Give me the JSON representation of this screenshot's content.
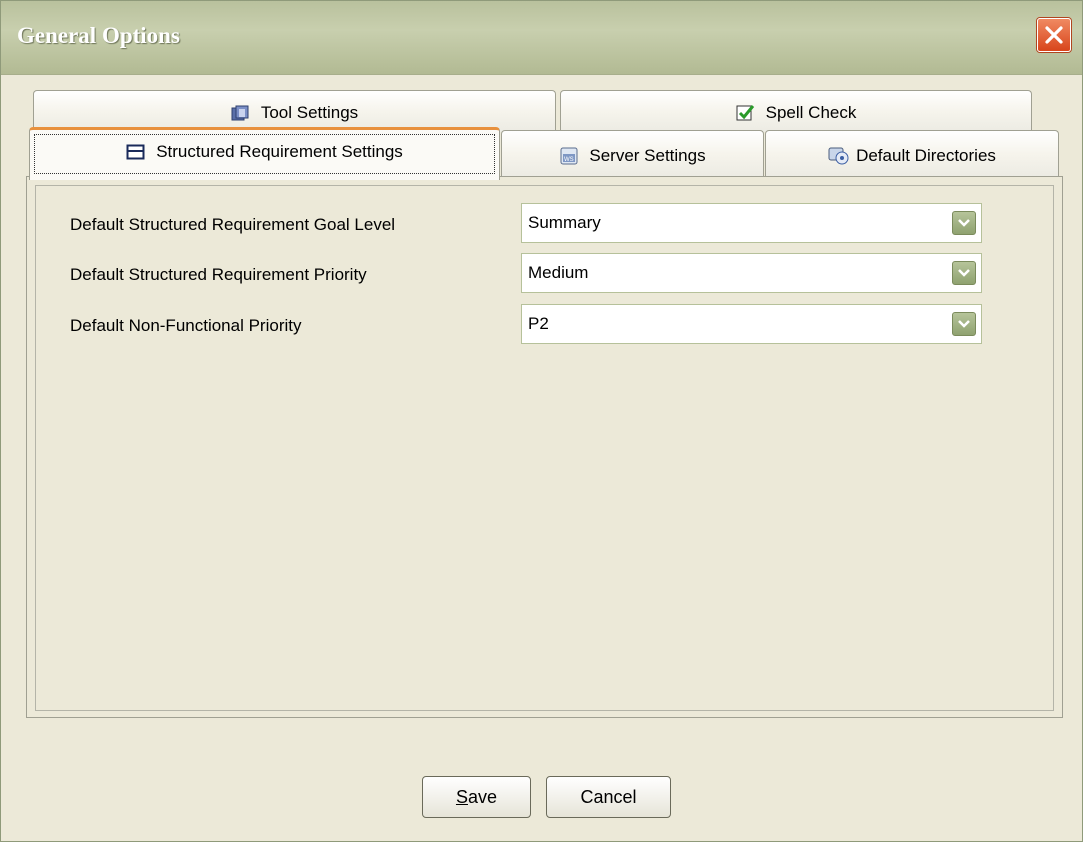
{
  "window": {
    "title": "General Options"
  },
  "tabs": {
    "row1": [
      {
        "label": "Tool Settings",
        "icon": "tool-settings-icon"
      },
      {
        "label": "Spell Check",
        "icon": "spell-check-icon"
      }
    ],
    "row2": [
      {
        "label": "Structured Requirement Settings",
        "icon": "structured-requirement-icon",
        "active": true
      },
      {
        "label": "Server Settings",
        "icon": "server-settings-icon"
      },
      {
        "label": "Default Directories",
        "icon": "default-directories-icon"
      }
    ]
  },
  "form": {
    "goal_level": {
      "label": "Default Structured Requirement Goal Level",
      "value": "Summary"
    },
    "priority": {
      "label": "Default Structured Requirement Priority",
      "value": "Medium"
    },
    "nf_priority": {
      "label": "Default Non-Functional Priority",
      "value": "P2"
    }
  },
  "buttons": {
    "save": {
      "mnemonic": "S",
      "rest": "ave"
    },
    "cancel": "Cancel"
  },
  "colors": {
    "active_tab_accent": "#e8913e",
    "titlebar": "#b9c19d",
    "close_button": "#d8451b"
  }
}
